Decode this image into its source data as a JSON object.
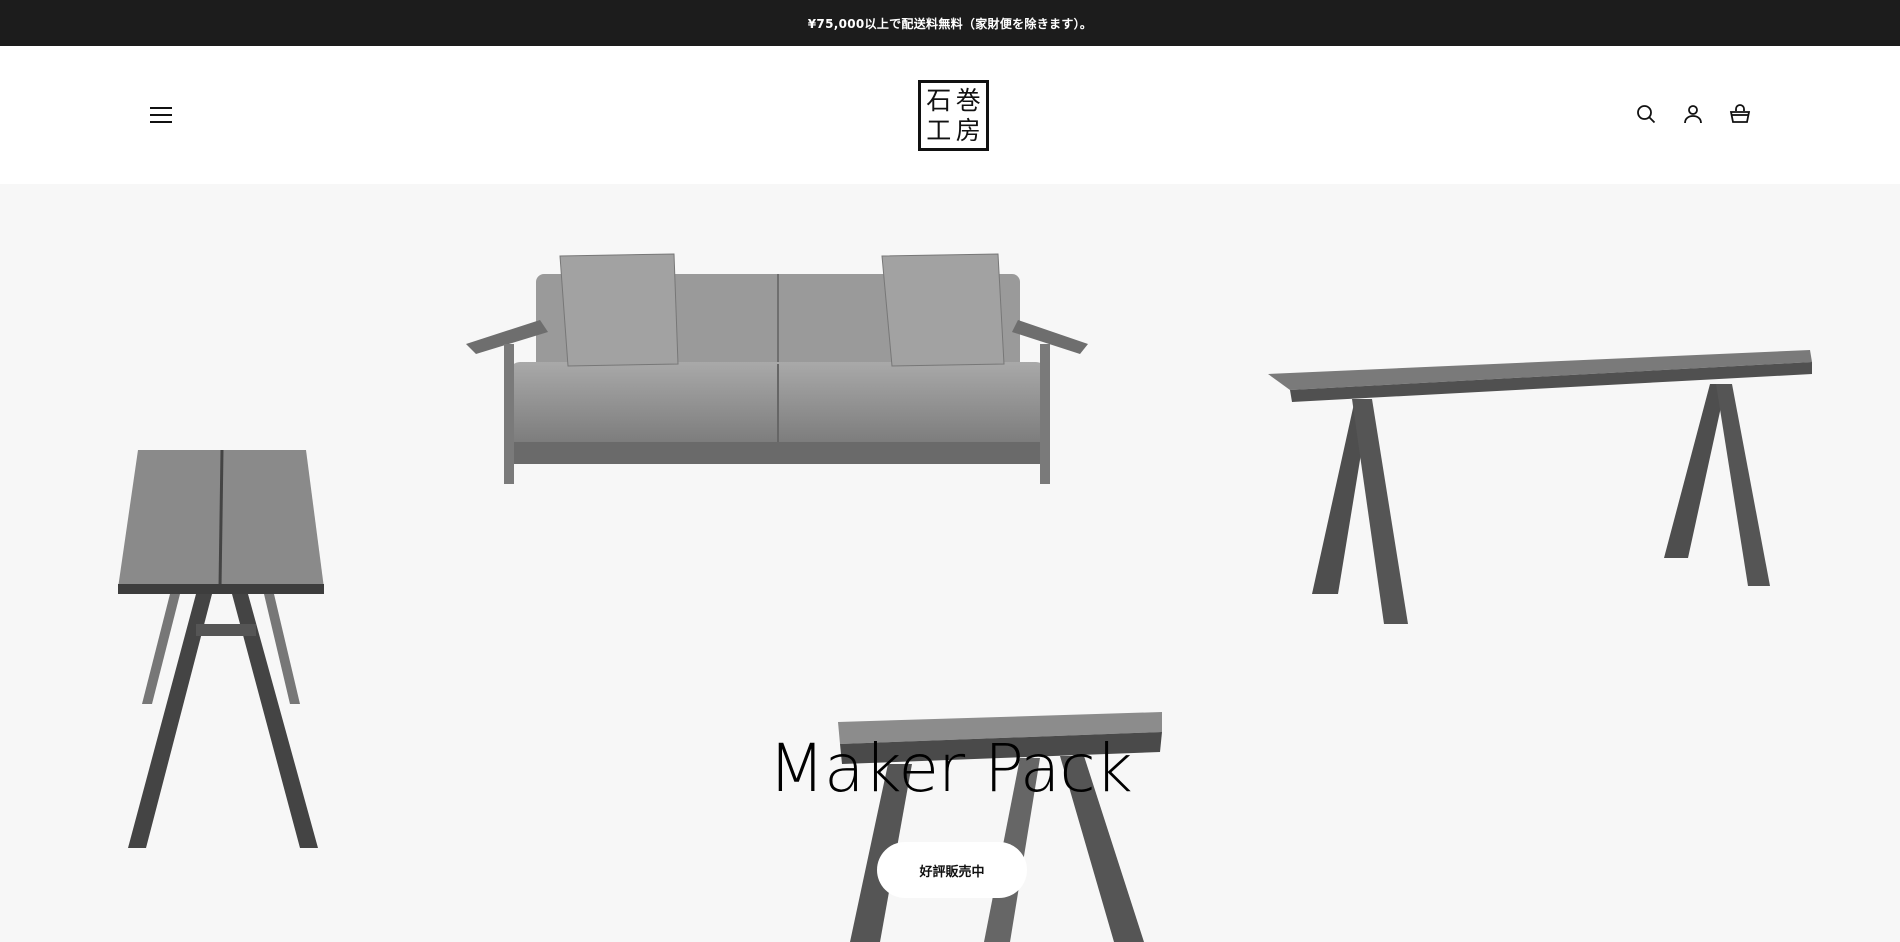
{
  "announcement": {
    "text": "¥75,000以上で配送料無料（家財便を除きます）。"
  },
  "header": {
    "logo_chars": [
      "石",
      "巻",
      "工",
      "房"
    ],
    "icons": [
      "menu-icon",
      "search-icon",
      "account-icon",
      "cart-icon"
    ]
  },
  "hero": {
    "title": "Maker Pack",
    "button_label": "好評販売中",
    "products": [
      "sofa",
      "long-table",
      "stool",
      "small-table"
    ]
  },
  "colors": {
    "announcement_bg": "#1c1c1c",
    "hero_bg": "#f7f7f7",
    "text": "#111111"
  }
}
